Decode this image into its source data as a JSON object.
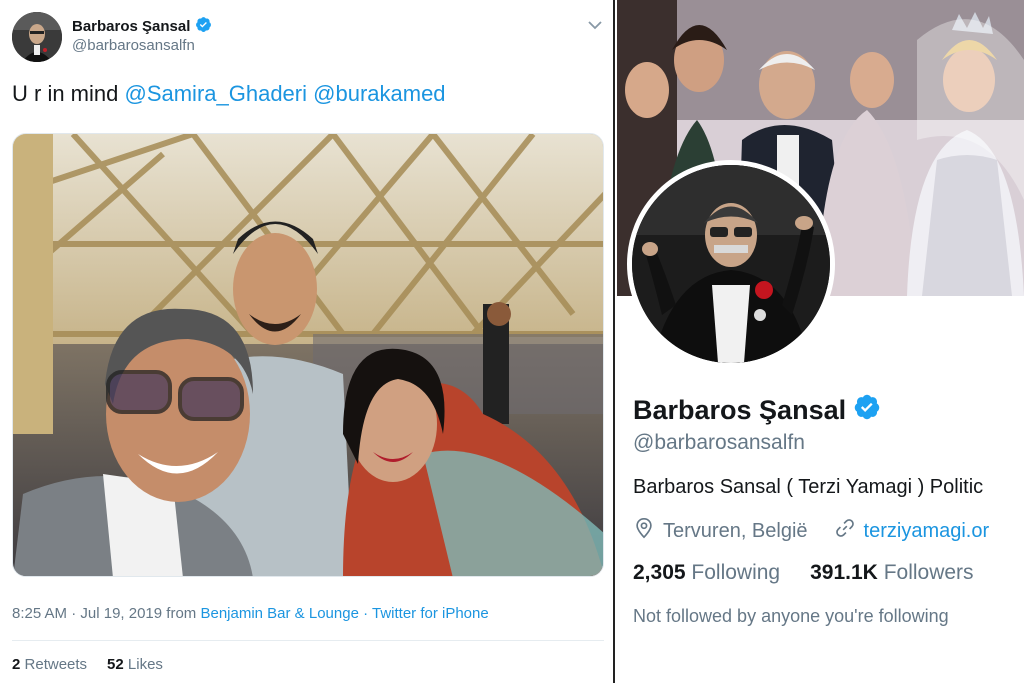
{
  "tweet": {
    "display_name": "Barbaros Şansal",
    "handle": "@barbarosansalfn",
    "text_prefix": "U r in mind",
    "mentions": [
      "@Samira_Ghaderi",
      "@burakamed"
    ],
    "time": "8:25 AM",
    "date": "Jul 19, 2019",
    "from_label": "from",
    "location_link": "Benjamin Bar & Lounge",
    "source": "Twitter for iPhone",
    "retweets_count": "2",
    "retweets_label": "Retweets",
    "likes_count": "52",
    "likes_label": "Likes"
  },
  "profile": {
    "display_name": "Barbaros Şansal",
    "handle": "@barbarosansalfn",
    "bio": "Barbaros Sansal ( Terzi Yamagi ) Politic",
    "location": "Tervuren, België",
    "website": "terziyamagi.or",
    "following_count": "2,305",
    "following_label": "Following",
    "followers_count": "391.1K",
    "followers_label": "Followers",
    "followed_by_note": "Not followed by anyone you're following"
  },
  "colors": {
    "link": "#1b95e0",
    "verified": "#1da1f2",
    "secondary_text": "#657786",
    "primary_text": "#14171a"
  },
  "icons": [
    "verified-badge-icon",
    "chevron-down-icon",
    "location-pin-icon",
    "link-icon"
  ]
}
